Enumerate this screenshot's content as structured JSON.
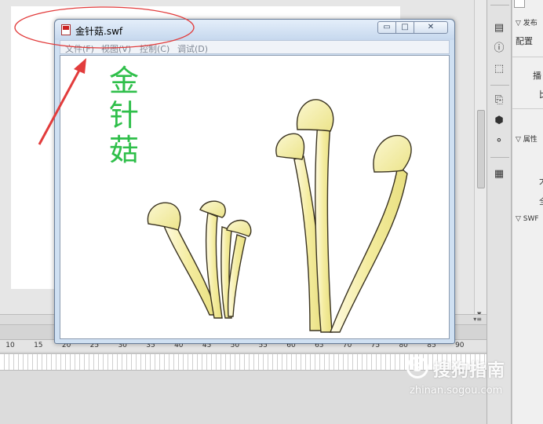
{
  "window": {
    "title": "金针菇.swf",
    "controls": {
      "minimize": "▭",
      "maximize": "□",
      "close": "✕"
    }
  },
  "menu": {
    "items": [
      {
        "label": "文件(F)"
      },
      {
        "label": "视图(V)"
      },
      {
        "label": "控制(C)"
      },
      {
        "label": "调试(D)"
      }
    ]
  },
  "content": {
    "title_chars": [
      "金",
      "针",
      "菇"
    ],
    "title_color": "#2fbf4a",
    "mushroom_fill": "#f6f0a6"
  },
  "ruler": {
    "numbers": [
      "10",
      "15",
      "20",
      "25",
      "30",
      "35",
      "40",
      "45",
      "50",
      "55",
      "60",
      "65",
      "70",
      "75",
      "80",
      "85",
      "90"
    ]
  },
  "right_panel": {
    "publish_label": "发布",
    "config_label": "配置",
    "label_b": "播",
    "label_c": "比",
    "properties_label": "属性",
    "label_d": "大",
    "label_e": "全",
    "swf_label": "SWF"
  },
  "tools": {
    "icons": [
      "align-icon",
      "info-icon",
      "transform-icon",
      "code-snippet-icon",
      "components-icon",
      "motion-presets-icon",
      "library-icon"
    ]
  },
  "watermark": {
    "logo_letter": "S",
    "brand": "搜狗指南",
    "url": "zhinan.sogou.com"
  },
  "annotation": {
    "color": "#e23c3c"
  }
}
